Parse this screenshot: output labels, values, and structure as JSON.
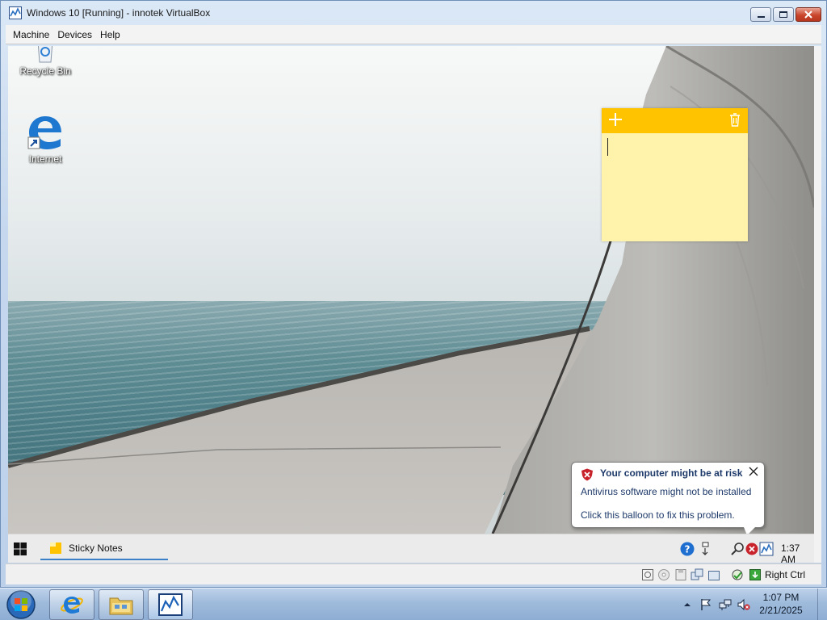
{
  "vbox": {
    "title": "Windows 10 [Running] - innotek VirtualBox",
    "menu": [
      "Machine",
      "Devices",
      "Help"
    ],
    "host_key": "Right Ctrl"
  },
  "desktop": {
    "icons": [
      {
        "label": "Recycle Bin",
        "icon": "recycle-bin-icon"
      },
      {
        "label": "Internet",
        "icon": "edge-browser-icon"
      }
    ]
  },
  "sticky_note": {
    "text": "",
    "color": "#fff2ab",
    "header_color": "#ffc300"
  },
  "balloon": {
    "title": "Your computer might be at risk",
    "line1": "Antivirus software might not be installed",
    "line2": "Click this balloon to fix this problem."
  },
  "guest_taskbar": {
    "task_label": "Sticky Notes",
    "clock": "1:37 AM"
  },
  "host_taskbar": {
    "time": "1:07 PM",
    "date": "2/21/2025"
  },
  "colors": {
    "accent": "#3a80c8",
    "sticky_yellow": "#ffc300",
    "shield_red": "#c8222b"
  }
}
